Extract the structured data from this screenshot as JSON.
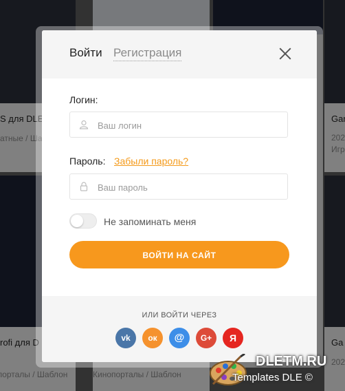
{
  "background": {
    "cards": [
      {
        "title": "S для DLE",
        "subtitle": "атные / Шабло"
      },
      {
        "title": "Gam",
        "subtitle": "202"
      },
      {
        "title": "Игр",
        "subtitle": ""
      },
      {
        "title": "rofi для D",
        "subtitle": "опорталы / Шаблон"
      },
      {
        "title": "Кинопорталы / Шаблон",
        "subtitle": ""
      },
      {
        "title": "Ga",
        "subtitle": "202"
      }
    ]
  },
  "modal": {
    "tabs": {
      "login": "Войти",
      "register": "Регистрация"
    },
    "login_label": "Логин:",
    "login_placeholder": "Ваш логин",
    "password_label": "Пароль:",
    "forgot_link": "Забыли пароль?",
    "password_placeholder": "Ваш пароль",
    "remember_label": "Не запоминать меня",
    "remember_checked": false,
    "submit_label": "ВОЙТИ НА САЙТ",
    "social_heading": "ИЛИ ВОЙТИ ЧЕРЕЗ",
    "social": [
      {
        "name": "vk",
        "glyph": "vk",
        "color": "#4a76a8"
      },
      {
        "name": "odnoklassniki",
        "glyph": "ок",
        "color": "#f5922e"
      },
      {
        "name": "mail",
        "glyph": "@",
        "color": "#3d8ee8"
      },
      {
        "name": "google-plus",
        "glyph": "G+",
        "color": "#dd4b39"
      },
      {
        "name": "yandex",
        "glyph": "Я",
        "color": "#e52620"
      }
    ],
    "accent_color": "#f7981d"
  },
  "watermark": {
    "site": "DLETM.RU",
    "sub": "Templates DLE ©"
  }
}
